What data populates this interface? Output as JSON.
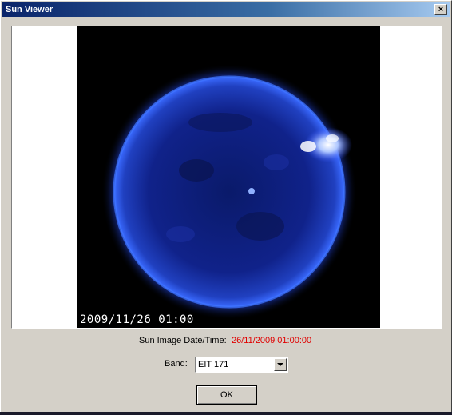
{
  "window": {
    "title": "Sun Viewer",
    "close_label": "×"
  },
  "image_panel": {
    "timestamp_overlay": "2009/11/26 01:00"
  },
  "info": {
    "date_label": "Sun Image Date/Time:",
    "date_value": "26/11/2009 01:00:00",
    "date_value_color": "#e00000"
  },
  "band": {
    "label": "Band:",
    "selected": "EIT 171"
  },
  "buttons": {
    "ok_label": "OK"
  }
}
